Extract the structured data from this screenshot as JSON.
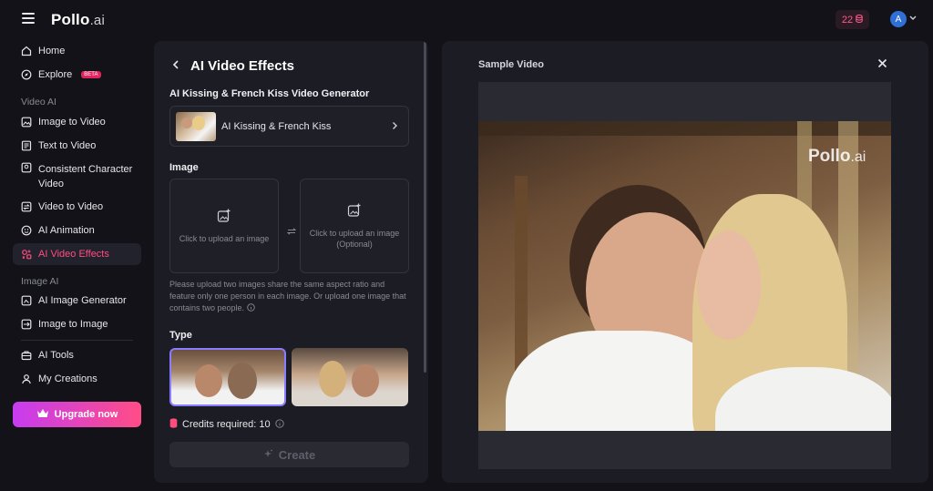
{
  "brand": {
    "name": "Pollo",
    "suffix": ".ai"
  },
  "header": {
    "credits": "22",
    "avatar_letter": "A"
  },
  "sidebar": {
    "items_top": [
      {
        "label": "Home"
      },
      {
        "label": "Explore",
        "badge": "BETA"
      }
    ],
    "section_video": "Video AI",
    "video_items": [
      {
        "label": "Image to Video"
      },
      {
        "label": "Text to Video"
      },
      {
        "label": "Consistent Character Video"
      },
      {
        "label": "Video to Video"
      },
      {
        "label": "AI Animation"
      },
      {
        "label": "AI Video Effects"
      }
    ],
    "section_image": "Image AI",
    "image_items": [
      {
        "label": "AI Image Generator"
      },
      {
        "label": "Image to Image"
      }
    ],
    "bottom_items": [
      {
        "label": "AI Tools"
      },
      {
        "label": "My Creations"
      }
    ],
    "upgrade_label": "Upgrade now"
  },
  "panel": {
    "title": "AI Video Effects",
    "generator_label": "AI Kissing & French Kiss Video Generator",
    "selected_effect": "AI Kissing & French Kiss",
    "image_label": "Image",
    "upload1": "Click to upload an image",
    "upload2_line1": "Click to upload an image",
    "upload2_line2": "(Optional)",
    "hint": "Please upload two images share the same aspect ratio and feature only one person in each image. Or upload one image that contains two people.",
    "type_label": "Type",
    "credits_text": "Credits required: 10",
    "create_label": "Create"
  },
  "preview": {
    "title": "Sample Video",
    "watermark_name": "Pollo",
    "watermark_suffix": ".ai"
  },
  "colors": {
    "accent": "#ff4d80",
    "upgrade_start": "#c63cf0",
    "upgrade_end": "#ff4d86"
  }
}
